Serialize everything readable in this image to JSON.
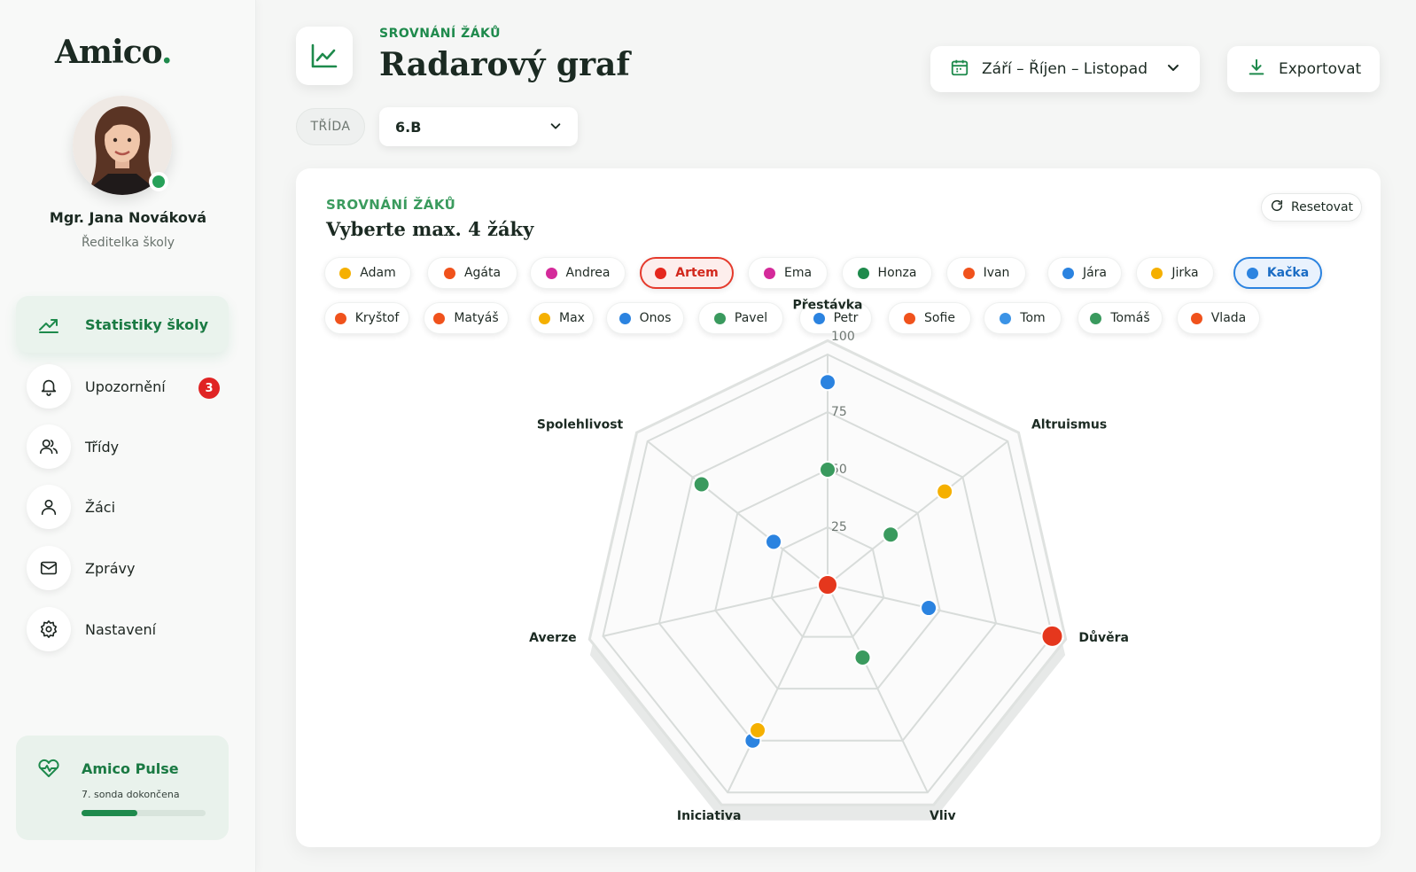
{
  "sidebar": {
    "logo": "Amico",
    "logo_dot": ".",
    "user": {
      "name": "Mgr. Jana Nováková",
      "role": "Ředitelka školy"
    },
    "nav": [
      {
        "label": "Statistiky školy",
        "icon": "chart-line-icon",
        "active": true
      },
      {
        "label": "Upozornění",
        "icon": "bell-icon",
        "badge": "3"
      },
      {
        "label": "Třídy",
        "icon": "users-icon"
      },
      {
        "label": "Žáci",
        "icon": "user-icon"
      },
      {
        "label": "Zprávy",
        "icon": "mail-icon"
      },
      {
        "label": "Nastavení",
        "icon": "gear-icon"
      }
    ],
    "pulse": {
      "title": "Amico Pulse",
      "subtitle": "7. sonda dokončena",
      "progress": 0.45
    }
  },
  "header": {
    "eyebrow": "SROVNÁNÍ ŽÁKŮ",
    "title": "Radarový graf",
    "period": "Září – Říjen – Listopad",
    "export": "Exportovat",
    "class_label": "TŘÍDA",
    "class_value": "6.B"
  },
  "card": {
    "eyebrow": "SROVNÁNÍ ŽÁKŮ",
    "title": "Vyberte max. 4 žáky",
    "reset": "Resetovat",
    "chips_row1": [
      {
        "label": "Adam",
        "color": "#f5b000"
      },
      {
        "label": "Agáta",
        "color": "#f0521c"
      },
      {
        "label": "Andrea",
        "color": "#d42a9a"
      },
      {
        "label": "Artem",
        "color": "#e5271d",
        "selected": "red"
      },
      {
        "label": "Ema",
        "color": "#d42a9a"
      },
      {
        "label": "Honza",
        "color": "#1e8a4c"
      },
      {
        "label": "Ivan",
        "color": "#f0521c"
      },
      {
        "label": "Jára",
        "color": "#2b83e0"
      },
      {
        "label": "Jirka",
        "color": "#f5b000"
      },
      {
        "label": "Kačka",
        "color": "#2b83e0",
        "selected": "blue"
      }
    ],
    "chips_row2": [
      {
        "label": "Kryštof",
        "color": "#f0521c"
      },
      {
        "label": "Matyáš",
        "color": "#f0521c"
      },
      {
        "label": "Max",
        "color": "#f5b000"
      },
      {
        "label": "Onos",
        "color": "#2b83e0"
      },
      {
        "label": "Pavel",
        "color": "#3a9a5e"
      },
      {
        "label": "Petr",
        "color": "#2b83e0"
      },
      {
        "label": "Sofie",
        "color": "#f0521c"
      },
      {
        "label": "Tom",
        "color": "#3b93e6"
      },
      {
        "label": "Tomáš",
        "color": "#3a9a5e"
      },
      {
        "label": "Vlada",
        "color": "#f0521c"
      }
    ]
  },
  "chart_data": {
    "type": "radar",
    "axes": [
      "Přestávka",
      "Altruismus",
      "Důvěra",
      "Vliv",
      "Iniciativa",
      "Averze",
      "Spolehlivost"
    ],
    "ticks": [
      "25",
      "50",
      "75",
      "100"
    ],
    "range": [
      0,
      100
    ],
    "series": [
      {
        "color": "#e5371d",
        "values": [
          0,
          35,
          100,
          0,
          0,
          0,
          70
        ]
      },
      {
        "color": "#2b83e0",
        "values": [
          88,
          0,
          45,
          0,
          75,
          0,
          30
        ]
      },
      {
        "color": "#f5b000",
        "values": [
          0,
          65,
          0,
          0,
          70,
          0,
          0
        ]
      },
      {
        "color": "#3a9a5e",
        "values": [
          50,
          35,
          0,
          35,
          0,
          0,
          70
        ]
      }
    ]
  }
}
